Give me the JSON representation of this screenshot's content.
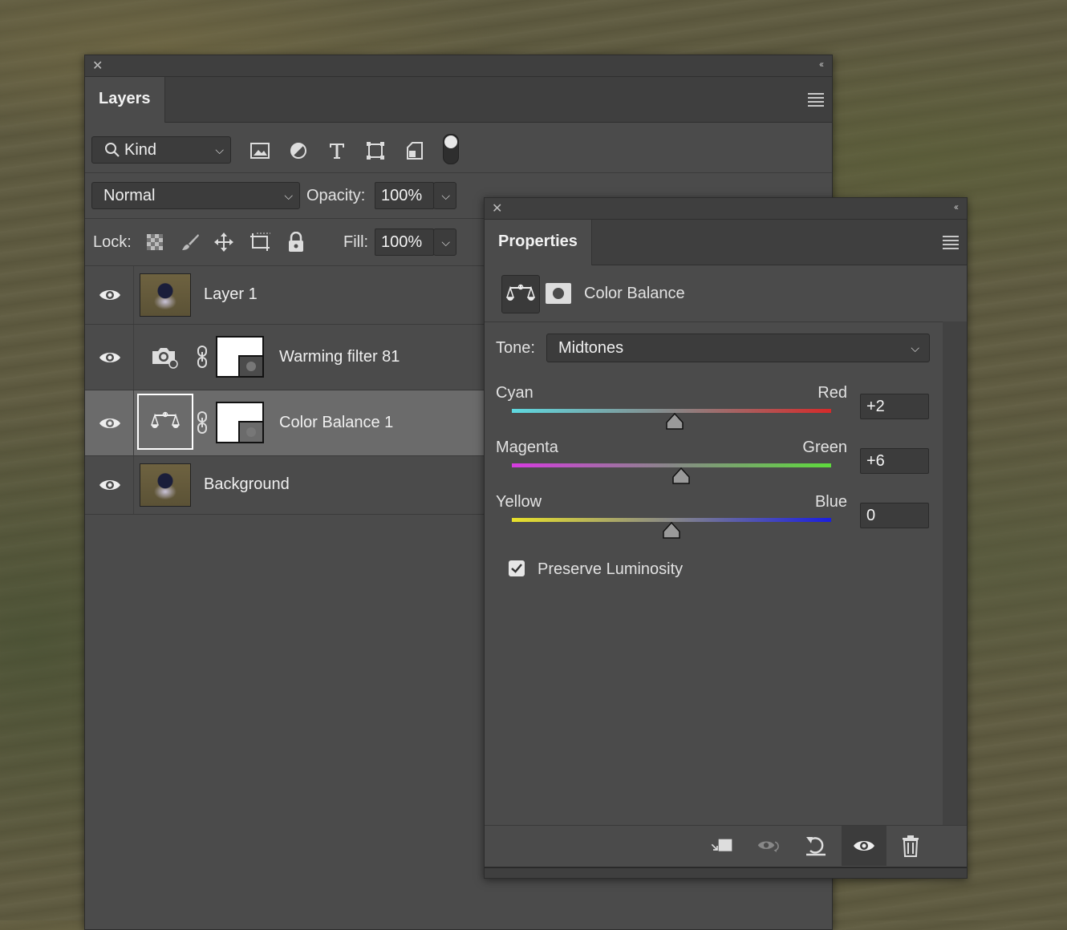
{
  "layers_panel": {
    "title": "Layers",
    "filter_kind": "Kind",
    "blend_mode": "Normal",
    "opacity_label": "Opacity:",
    "opacity_value": "100%",
    "lock_label": "Lock:",
    "fill_label": "Fill:",
    "fill_value": "100%",
    "layers": [
      {
        "name": "Layer 1",
        "type": "pixel"
      },
      {
        "name": "Warming filter 81",
        "type": "photo-filter-adjustment"
      },
      {
        "name": "Color Balance 1",
        "type": "color-balance-adjustment",
        "selected": true
      },
      {
        "name": "Background",
        "type": "pixel"
      }
    ]
  },
  "properties_panel": {
    "title": "Properties",
    "adjustment_name": "Color Balance",
    "tone_label": "Tone:",
    "tone_value": "Midtones",
    "sliders": [
      {
        "left": "Cyan",
        "right": "Red",
        "value": "+2",
        "gradient": [
          "#5ed9e0",
          "#d62a2a"
        ]
      },
      {
        "left": "Magenta",
        "right": "Green",
        "value": "+6",
        "gradient": [
          "#d63be0",
          "#5edb3c"
        ]
      },
      {
        "left": "Yellow",
        "right": "Blue",
        "value": "0",
        "gradient": [
          "#e8e12a",
          "#1a1ee0"
        ]
      }
    ],
    "preserve_luminosity_label": "Preserve Luminosity",
    "preserve_luminosity_checked": true
  }
}
